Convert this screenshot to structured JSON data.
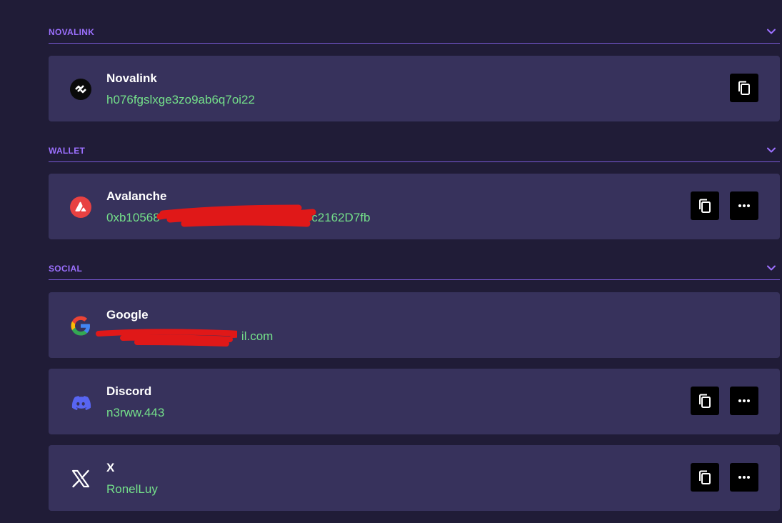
{
  "sections": {
    "novalink": {
      "title": "NOVALINK"
    },
    "wallet": {
      "title": "WALLET"
    },
    "social": {
      "title": "SOCIAL"
    }
  },
  "accounts": {
    "novalink": {
      "name": "Novalink",
      "value": "h076fgslxge3zo9ab6q7oi22",
      "icon": "novalink-icon"
    },
    "avalanche": {
      "name": "Avalanche",
      "value": "0xb10568                                         3ec2162D7fb",
      "icon": "avalanche-icon"
    },
    "google": {
      "name": "Google",
      "value": "                                        il.com",
      "icon": "google-icon"
    },
    "discord": {
      "name": "Discord",
      "value": "n3rww.443",
      "icon": "discord-icon"
    },
    "x": {
      "name": "X",
      "value": "RonelLuy",
      "icon": "x-icon"
    }
  },
  "colors": {
    "background": "#201c37",
    "card": "#37325c",
    "section_title": "#9c70ff",
    "divider": "#7a59d6",
    "value_text": "#74e08a",
    "redaction": "#e01818"
  },
  "icons": {
    "collapse": "chevron-down-icon",
    "copy": "copy-icon",
    "more": "more-icon"
  }
}
